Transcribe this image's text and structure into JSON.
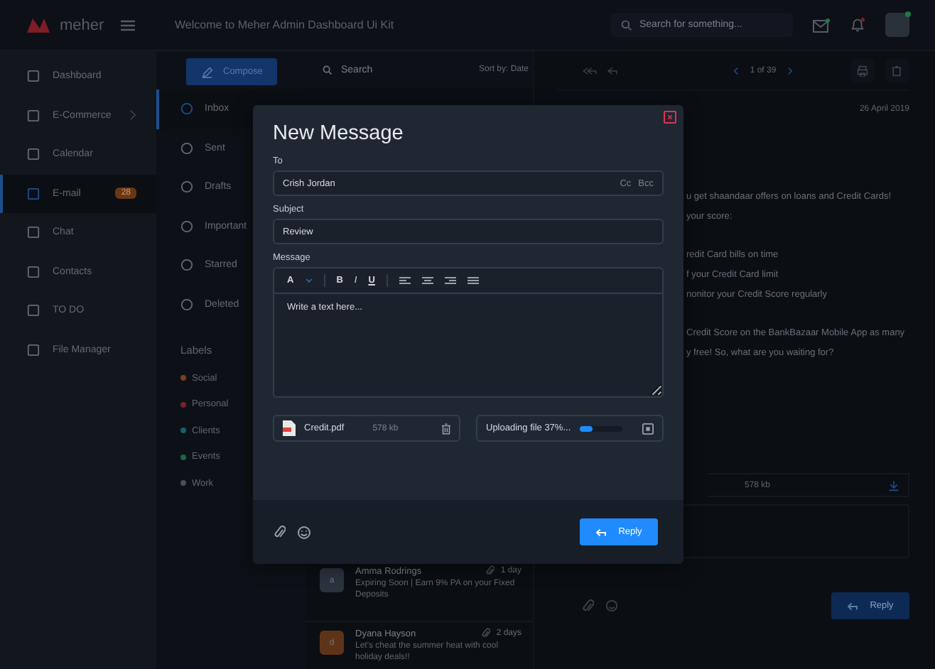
{
  "header": {
    "logo": "meher",
    "welcome": "Welcome to Meher Admin Dashboard Ui Kit",
    "search_placeholder": "Search for something..."
  },
  "sidebar": {
    "items": [
      {
        "label": "Dashboard",
        "selected": false,
        "kind": "link"
      },
      {
        "label": "E-Commerce",
        "selected": false,
        "kind": "submenu"
      },
      {
        "label": "Calendar",
        "selected": false,
        "kind": "link"
      },
      {
        "label": "E-mail",
        "selected": true,
        "kind": "link",
        "badge": "28"
      },
      {
        "label": "Chat",
        "selected": false,
        "kind": "link"
      },
      {
        "label": "Contacts",
        "selected": false,
        "kind": "link"
      },
      {
        "label": "TO DO",
        "selected": false,
        "kind": "link"
      },
      {
        "label": "File Manager",
        "selected": false,
        "kind": "link"
      }
    ]
  },
  "mail_nav": {
    "compose": "Compose",
    "folders": [
      {
        "label": "Inbox",
        "selected": true
      },
      {
        "label": "Sent",
        "selected": false
      },
      {
        "label": "Drafts",
        "selected": false
      },
      {
        "label": "Important",
        "selected": false
      },
      {
        "label": "Starred",
        "selected": false
      },
      {
        "label": "Deleted",
        "selected": false
      }
    ],
    "labels_heading": "Labels",
    "labels": [
      {
        "label": "Social",
        "color": "#7a3f1c"
      },
      {
        "label": "Personal",
        "color": "#7a1f2a"
      },
      {
        "label": "Clients",
        "color": "#16606a"
      },
      {
        "label": "Events",
        "color": "#176a3e"
      },
      {
        "label": "Work",
        "color": "#4a4f57"
      }
    ]
  },
  "mail_list": {
    "search_placeholder": "Search",
    "sort": "Sort by: Date",
    "items": [
      {
        "avatar": "a",
        "sender": "Amma Rodrings",
        "time": "1 day",
        "preview": "Expiring Soon | Earn 9% PA on your Fixed Deposits",
        "color": "#2b323d"
      },
      {
        "avatar": "d",
        "sender": "Dyana Hayson",
        "time": "2 days",
        "preview": "Let's cheat the summer heat with cool holiday deals!!",
        "color": "#5e3418"
      }
    ]
  },
  "reader": {
    "pager": "1 of 39",
    "date": "26 April 2019",
    "paragraphs": [
      [
        "u get shaandaar offers on loans and Credit Cards!",
        "your score:"
      ],
      [
        "redit Card bills on time",
        "f your Credit Card limit",
        "nonitor your Credit Score regularly"
      ],
      [
        "Credit Score on the BankBazaar Mobile App as many",
        "y free! So, what are you waiting for?"
      ]
    ],
    "attachment_size": "578 kb",
    "reply_button": "Reply"
  },
  "modal": {
    "title": "New Message",
    "to_label": "To",
    "to_value": "Crish Jordan",
    "cc": "Cc",
    "bcc": "Bcc",
    "subject_label": "Subject",
    "subject_value": "Review",
    "message_label": "Message",
    "font_button": "A",
    "format_buttons": [
      "B",
      "I",
      "U"
    ],
    "message_placeholder": "Write a text here...",
    "attachment": {
      "name": "Credit.pdf",
      "size": "578 kb"
    },
    "upload": {
      "text": "Uploading file 37%...",
      "level": 0.3
    },
    "reply_button": "Reply"
  }
}
